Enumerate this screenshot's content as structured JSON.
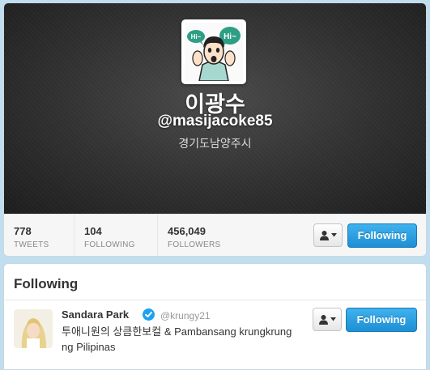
{
  "profile": {
    "name": "이광수",
    "handle": "@masijacoke85",
    "location": "경기도남양주시",
    "avatar_bubble_1": "Hi~",
    "avatar_bubble_2": "Hi~"
  },
  "stats": [
    {
      "value": "778",
      "label": "TWEETS"
    },
    {
      "value": "104",
      "label": "FOLLOWING"
    },
    {
      "value": "456,049",
      "label": "FOLLOWERS"
    }
  ],
  "actions": {
    "following_label": "Following"
  },
  "following_panel": {
    "title": "Following",
    "users": [
      {
        "name": "Sandara Park",
        "handle": "@krungy21",
        "bio": "투애니원의 상큼한보컬 & Pambansang krungkrung ng Pilipinas",
        "button_label": "Following"
      }
    ]
  },
  "colors": {
    "accent": "#2ba6e8",
    "page_bg": "#c0deed",
    "verified": "#1da1f2"
  },
  "icons": [
    "person-icon",
    "caret-down-icon",
    "verified-icon"
  ]
}
